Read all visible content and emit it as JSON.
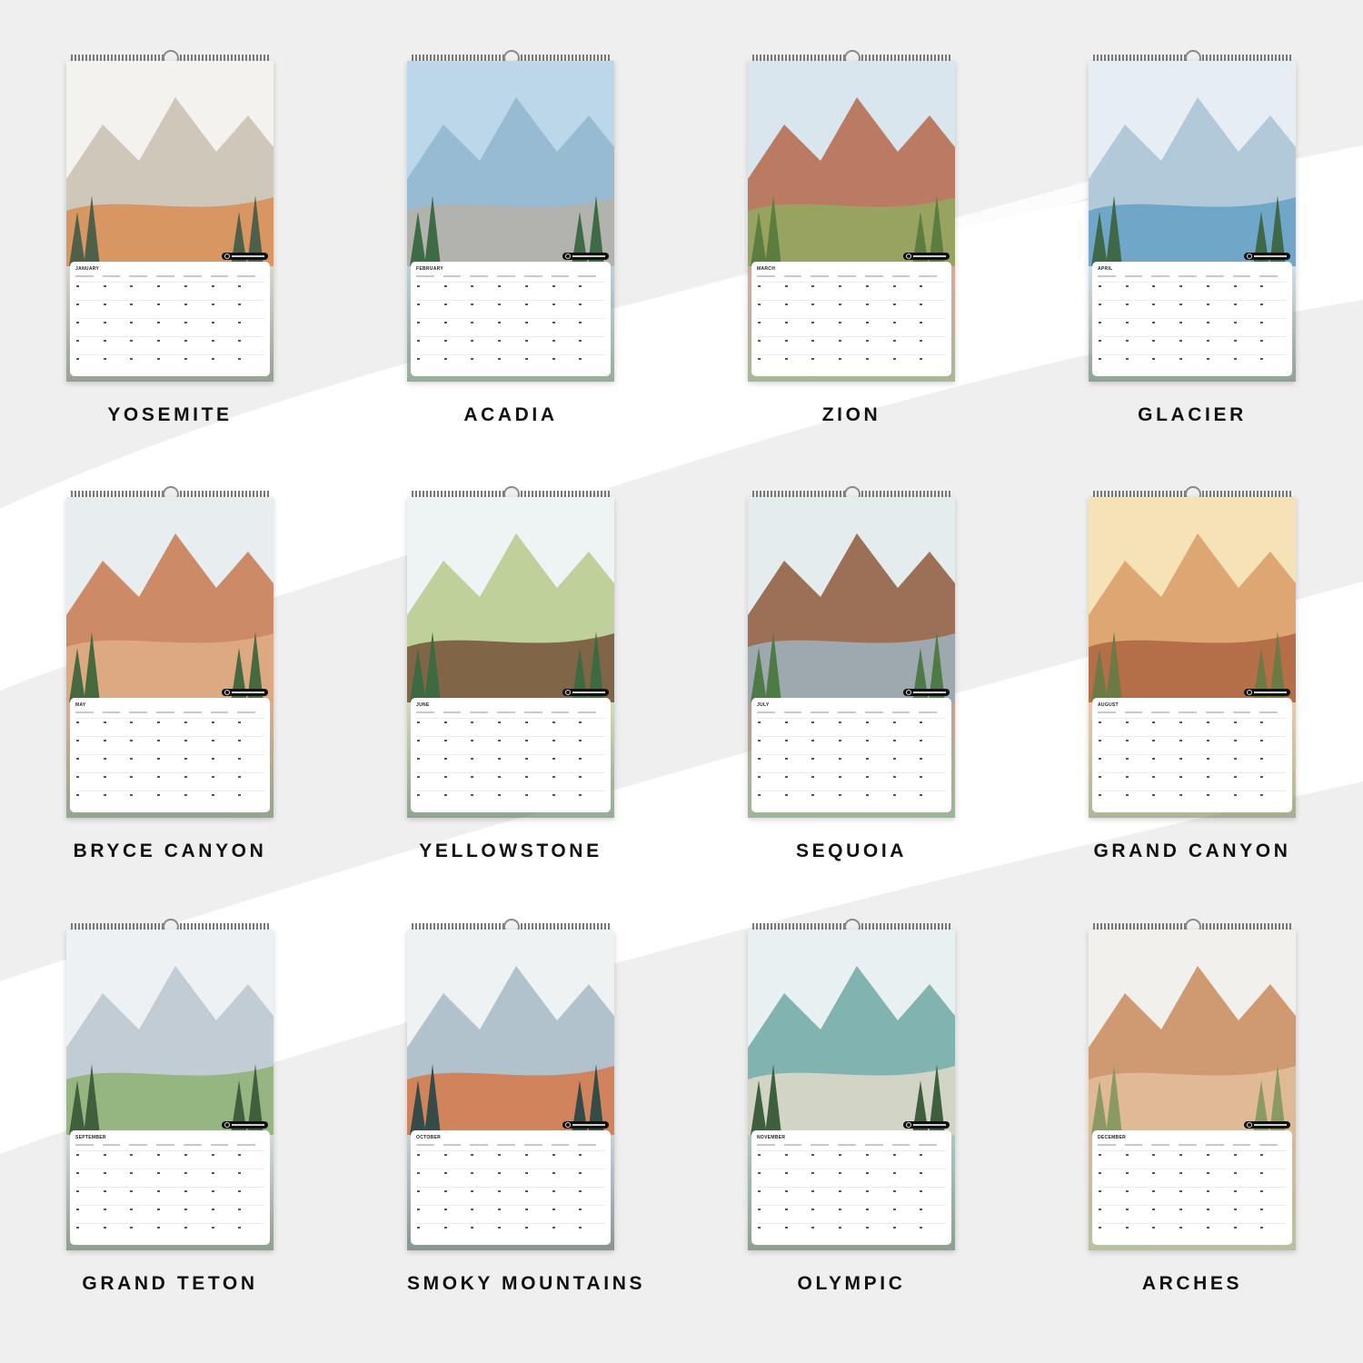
{
  "calendars": [
    {
      "park": "YOSEMITE",
      "month": "JANUARY",
      "palette": {
        "sky": "#f4f2ee",
        "land": "#c9c0b2",
        "accent": "#d88a4c",
        "trees": "#4e6148"
      }
    },
    {
      "park": "ACADIA",
      "month": "FEBRUARY",
      "palette": {
        "sky": "#bcd7ea",
        "land": "#8fb6cf",
        "accent": "#b9b1a6",
        "trees": "#3e6b45"
      }
    },
    {
      "park": "ZION",
      "month": "MARCH",
      "palette": {
        "sky": "#d9e6ee",
        "land": "#b5674a",
        "accent": "#8fae5d",
        "trees": "#5d7c3f"
      }
    },
    {
      "park": "GLACIER",
      "month": "APRIL",
      "palette": {
        "sky": "#e6eef3",
        "land": "#a8c2d4",
        "accent": "#5f9fc4",
        "trees": "#3f6848"
      }
    },
    {
      "park": "BRYCE CANYON",
      "month": "MAY",
      "palette": {
        "sky": "#e8eef0",
        "land": "#c8784d",
        "accent": "#e0b08a",
        "trees": "#47693f"
      }
    },
    {
      "park": "YELLOWSTONE",
      "month": "JUNE",
      "palette": {
        "sky": "#eef3f4",
        "land": "#b7c98b",
        "accent": "#6f4a32",
        "trees": "#3d6a40"
      }
    },
    {
      "park": "SEQUOIA",
      "month": "JULY",
      "palette": {
        "sky": "#e4ecee",
        "land": "#8f5a3c",
        "accent": "#9fb6c6",
        "trees": "#4d7a45"
      }
    },
    {
      "park": "GRAND CANYON",
      "month": "AUGUST",
      "palette": {
        "sky": "#f6e2b7",
        "land": "#d99b66",
        "accent": "#a9603d",
        "trees": "#6c7a43"
      }
    },
    {
      "park": "GRAND TETON",
      "month": "SEPTEMBER",
      "palette": {
        "sky": "#edf1f3",
        "land": "#b9c6ce",
        "accent": "#8ab06a",
        "trees": "#3f5f3d"
      }
    },
    {
      "park": "SMOKY MOUNTAINS",
      "month": "OCTOBER",
      "palette": {
        "sky": "#eff2f3",
        "land": "#a6bac6",
        "accent": "#d9743f",
        "trees": "#344b47"
      }
    },
    {
      "park": "OLYMPIC",
      "month": "NOVEMBER",
      "palette": {
        "sky": "#e9f0f2",
        "land": "#6fa8a4",
        "accent": "#e6dccb",
        "trees": "#3e5f3d"
      }
    },
    {
      "park": "ARCHES",
      "month": "DECEMBER",
      "palette": {
        "sky": "#f1f0ec",
        "land": "#c98a5c",
        "accent": "#e3c2a0",
        "trees": "#8a9a62"
      }
    }
  ]
}
